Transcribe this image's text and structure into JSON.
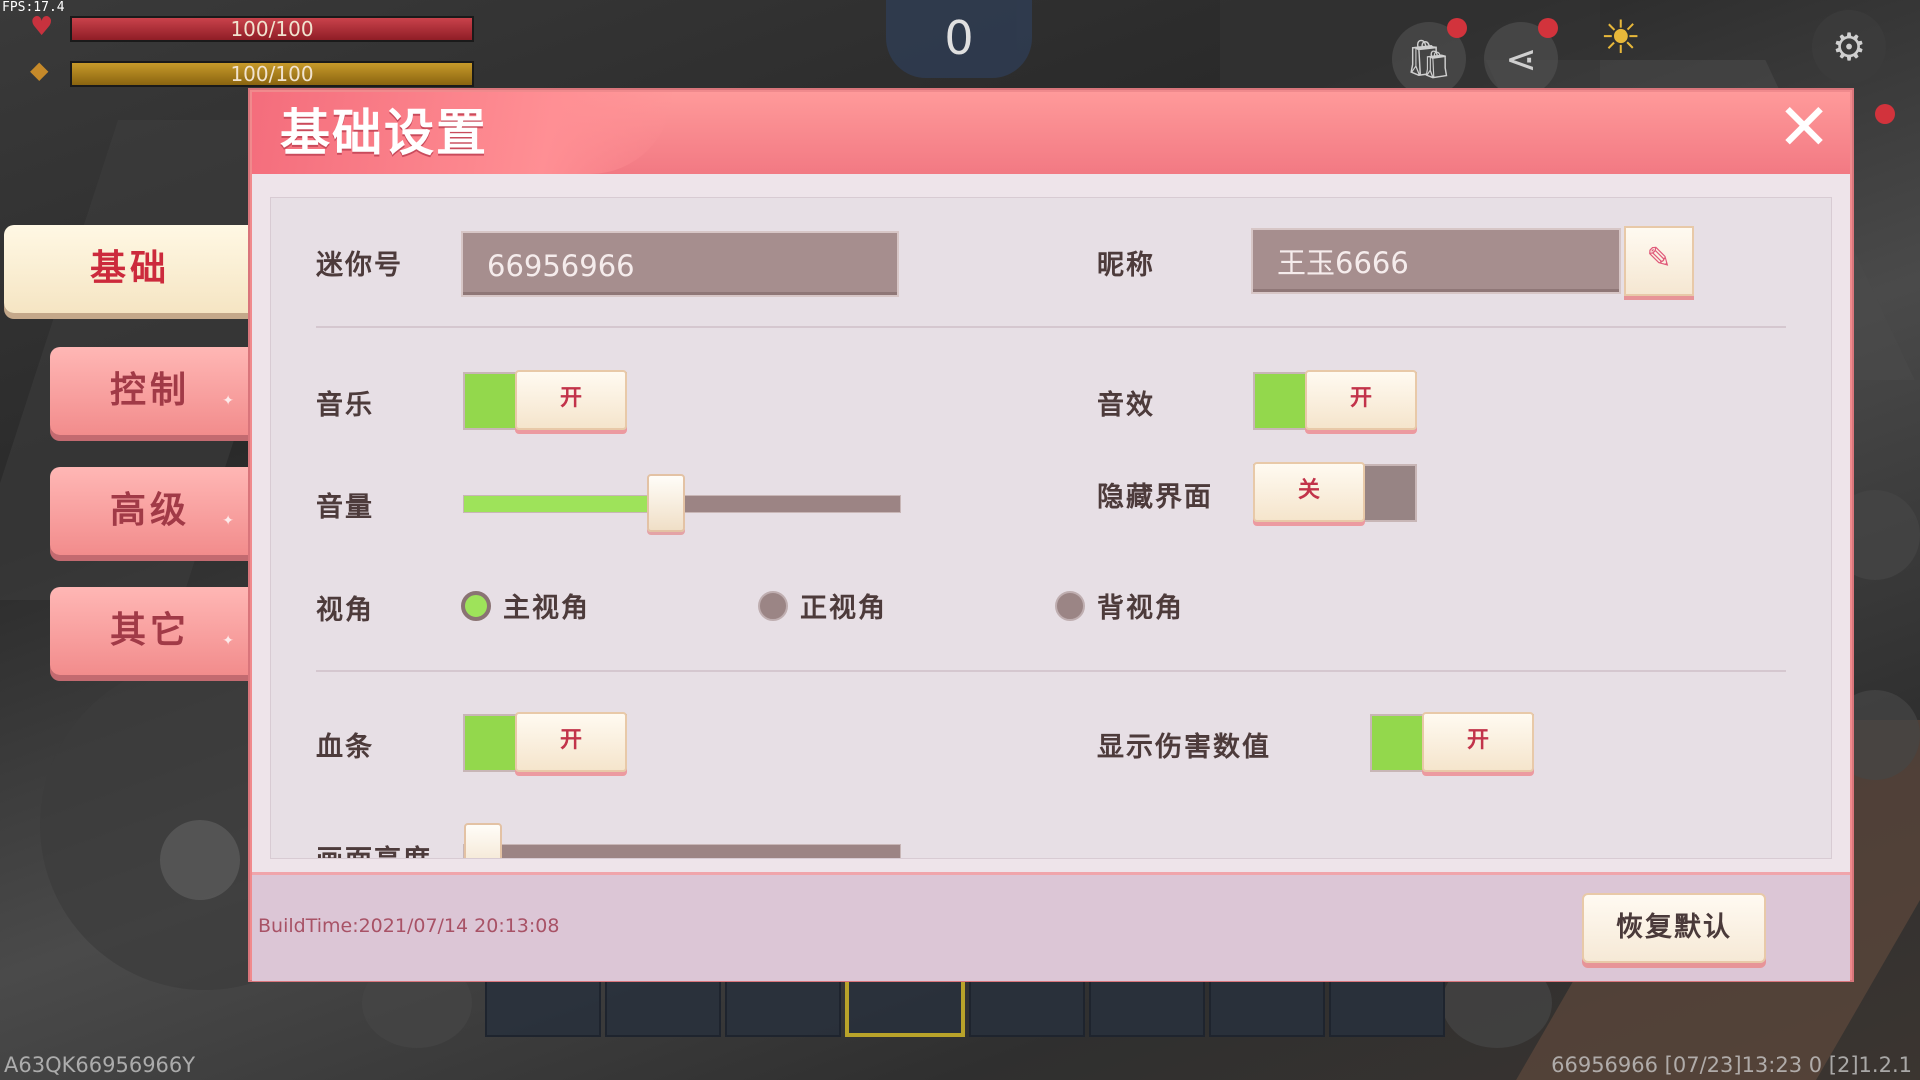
{
  "hud": {
    "fps": "FPS:17.4",
    "health_text": "100/100",
    "hunger_text": "100/100",
    "counter": "0",
    "player_code": "A63QK66956966Y",
    "footer_info": "66956966   [07/23]13:23 0   [2]1.2.1"
  },
  "tabs": [
    {
      "label": "基础",
      "active": true
    },
    {
      "label": "控制",
      "active": false
    },
    {
      "label": "高级",
      "active": false
    },
    {
      "label": "其它",
      "active": false
    }
  ],
  "dialog": {
    "title": "基础设置",
    "close_icon": "close-icon",
    "build_time": "BuildTime:2021/07/14 20:13:08",
    "reset_label": "恢复默认"
  },
  "settings": {
    "mini_id_label": "迷你号",
    "mini_id_value": "66956966",
    "nickname_label": "昵称",
    "nickname_value": "王玉6666",
    "music_label": "音乐",
    "music_state": "开",
    "sfx_label": "音效",
    "sfx_state": "开",
    "volume_label": "音量",
    "volume_level": 0.46,
    "hide_ui_label": "隐藏界面",
    "hide_ui_state": "关",
    "view_label": "视角",
    "view_options": [
      "主视角",
      "正视角",
      "背视角"
    ],
    "view_selected": "主视角",
    "health_bar_label": "血条",
    "health_bar_state": "开",
    "damage_label": "显示伤害数值",
    "damage_state": "开",
    "brightness_label": "画面亮度",
    "brightness_level": 0.0
  },
  "colors": {
    "header": "#f27983",
    "toggle_on": "#93d84c",
    "toggle_off": "#978484",
    "body": "#e7dfe5"
  }
}
